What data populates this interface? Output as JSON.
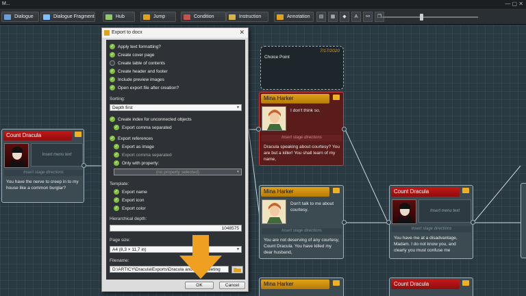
{
  "app": {
    "title": "M..."
  },
  "toolbar": {
    "items": [
      {
        "label": "Dialogue",
        "color": "#6aa0d8"
      },
      {
        "label": "Dialogue Fragment",
        "color": "#7fbfff"
      },
      {
        "label": "Hub",
        "color": "#8fc86b"
      },
      {
        "label": "Jump",
        "color": "#e0a21a"
      },
      {
        "label": "Condition",
        "color": "#c9524f"
      },
      {
        "label": "Instruction",
        "color": "#d4b44a"
      },
      {
        "label": "Annotation",
        "color": "#e0a21a"
      }
    ],
    "icons": [
      "layout-icon",
      "grid-icon",
      "snap-icon",
      "font-icon",
      "link-icon",
      "copy-icon"
    ]
  },
  "nodes": {
    "count_dracula_left": {
      "speaker": "Count Dracula",
      "menu_text": "Insert menu text",
      "stage_directions": "Insert stage directions",
      "text": "You have the nerve to creep in to my house like a common burglar?"
    },
    "choice_point": {
      "date": "7/17/2020",
      "label": "Choice Point"
    },
    "mina_1": {
      "speaker": "Mina Harker",
      "menu_text": "I don't think so.",
      "stage_directions": "Insert stage directions",
      "text": "Dracula speaking about courtesy? You are but a killer! You shall learn of my name,"
    },
    "mina_2": {
      "speaker": "Mina Harker",
      "menu_text": "Don't talk to me about courtesy.",
      "stage_directions": "Insert stage directions",
      "text": "You are not deserving of any courtesy, Count Dracula. You have killed my dear husband,"
    },
    "dracula_right": {
      "speaker": "Count Dracula",
      "menu_text": "Insert menu text",
      "stage_directions": "Insert stage directions",
      "text": "You have me at a disadvantage, Madam. I do not know you, and clearly you must confuse me"
    },
    "mina_3": {
      "speaker": "Mina Harker"
    },
    "dracula_bottom": {
      "speaker": "Count Dracula"
    }
  },
  "dialog": {
    "title": "Export to docx",
    "options": [
      {
        "label": "Apply text formatting?",
        "checked": true
      },
      {
        "label": "Create cover page",
        "checked": true
      },
      {
        "label": "Create table of contents",
        "checked": false
      },
      {
        "label": "Create header and footer",
        "checked": true
      },
      {
        "label": "Include preview images",
        "checked": true
      },
      {
        "label": "Open export file after creation?",
        "checked": true
      }
    ],
    "sorting_label": "Sorting:",
    "sorting_value": "Depth first",
    "index_label": "Create index for unconnected objects",
    "index_sub": "Export comma separated",
    "references_label": "Export references",
    "ref_image": "Export as image",
    "ref_comma": "Export comma separated",
    "ref_only": "Only with property:",
    "property_placeholder": "(no property selected)",
    "template_label": "Template:",
    "template_items": [
      "Export name",
      "Export icon",
      "Export color"
    ],
    "depth_label": "Hierarchical depth:",
    "depth_value": "1048575",
    "pagesize_label": "Page size:",
    "pagesize_value": "A4 (8,3 × 11,7 in)",
    "filename_label": "Filename:",
    "filename_value": "D:\\ARTICY\\Dracula\\Exports\\Dracula and Mina Meeting",
    "ok": "OK",
    "cancel": "Cancel"
  }
}
